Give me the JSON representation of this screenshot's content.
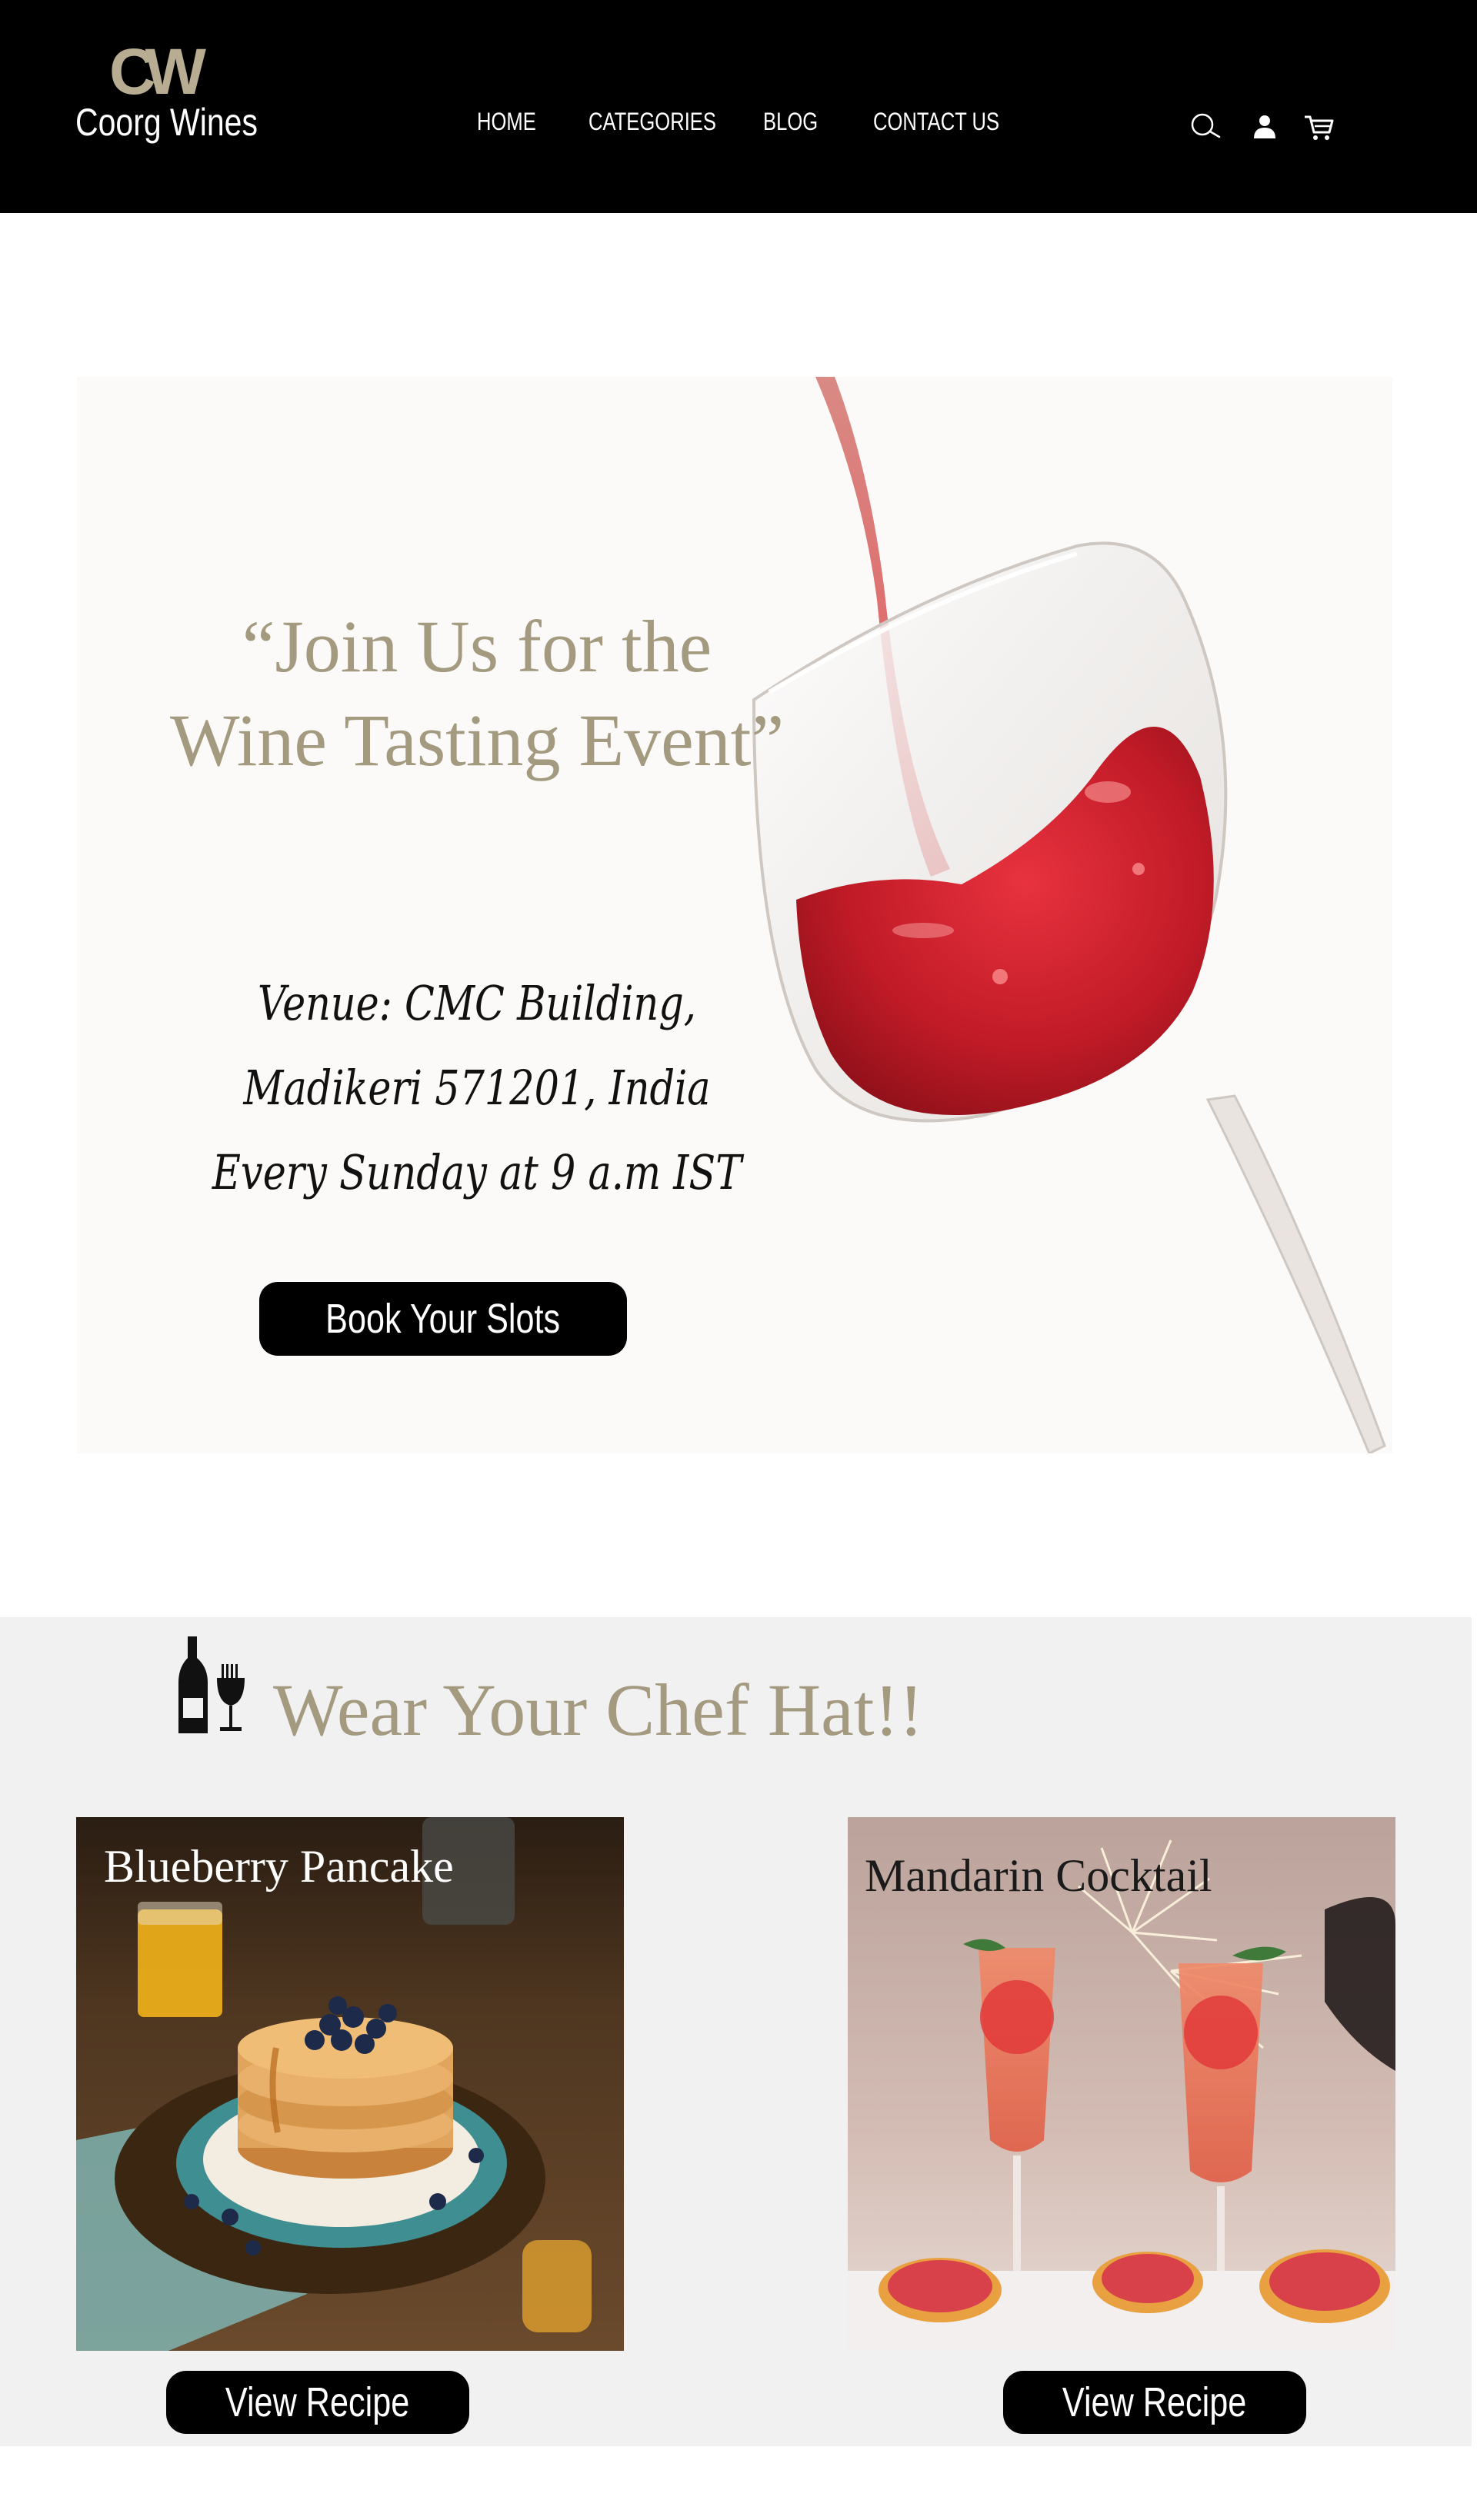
{
  "header": {
    "logo_monogram": "CW",
    "brand_name": "Coorg Wines",
    "nav": [
      "HOME",
      "CATEGORIES",
      "BLOG",
      "CONTACT US"
    ],
    "icons": [
      "search-icon",
      "user-icon",
      "cart-icon"
    ]
  },
  "hero": {
    "title_line1": "“Join Us for the",
    "title_line2": "Wine Tasting Event”",
    "venue_line1": "Venue: CMC Building,",
    "venue_line2": "Madikeri 571201, India",
    "schedule": "Every Sunday at 9 a.m IST",
    "cta_label": "Book Your Slots"
  },
  "recipes": {
    "section_title": "Wear Your Chef  Hat!!",
    "section_icon": "wine-bottle-fork-icon",
    "cards": [
      {
        "title": "Blueberry Pancake",
        "button_label": "View Recipe"
      },
      {
        "title": "Mandarin Cocktail",
        "button_label": "View Recipe"
      }
    ]
  },
  "colors": {
    "header_bg": "#000000",
    "accent_text": "#a39a80",
    "hero_bg": "#fcfaf8",
    "section_bg": "#f1f1f1",
    "wine": "#c4202b"
  }
}
